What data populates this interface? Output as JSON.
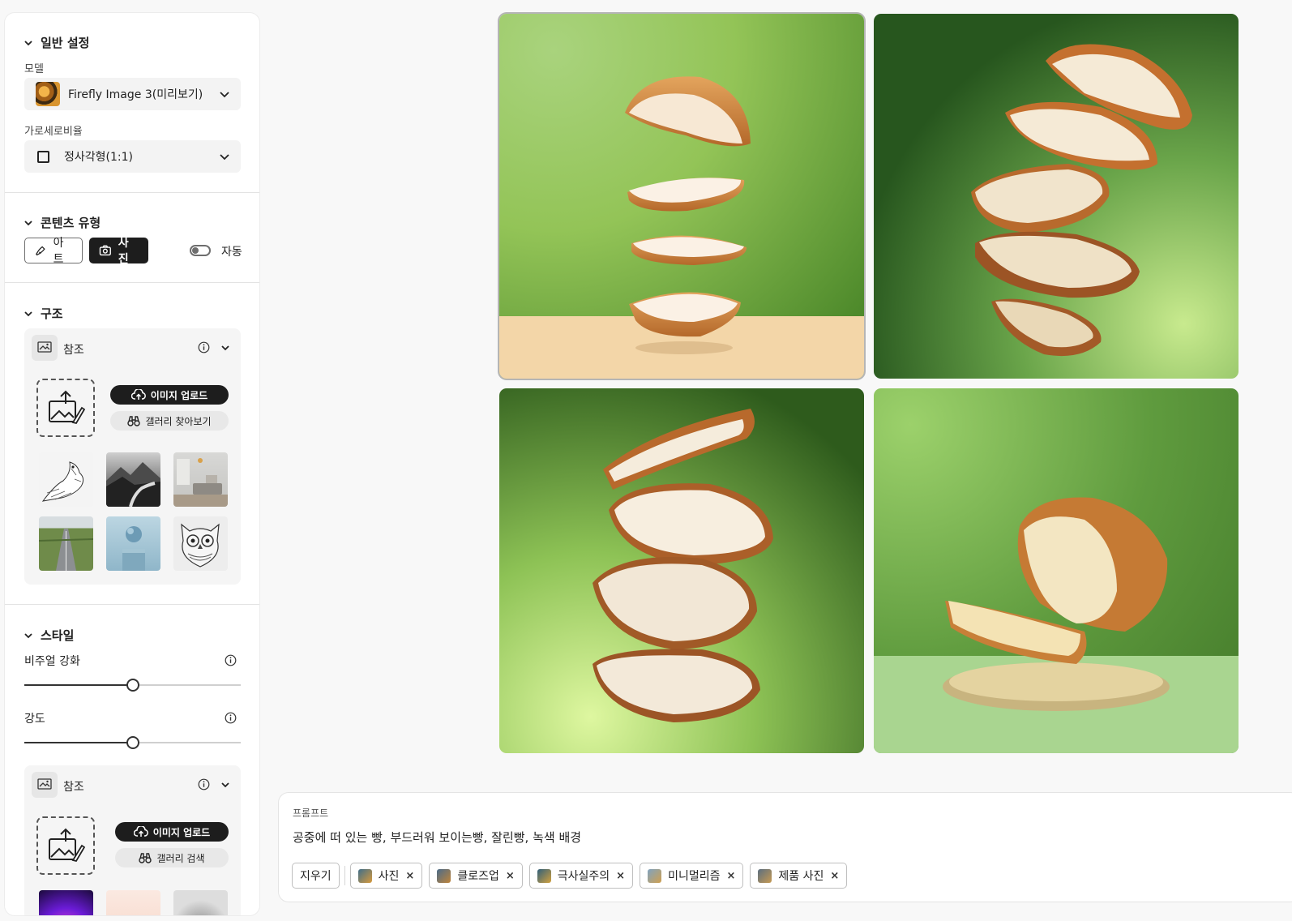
{
  "sidebar": {
    "general": {
      "title": "일반 설정",
      "model_label": "모델",
      "model_value": "Firefly Image 3(미리보기)",
      "aspect_label": "가로세로비율",
      "aspect_value": "정사각형(1:1)"
    },
    "content_type": {
      "title": "콘텐츠 유형",
      "art_label": "아트",
      "photo_label": "사진",
      "selected": "사진",
      "auto_label": "자동",
      "auto_on": false
    },
    "structure": {
      "title": "구조",
      "ref_title": "참조",
      "upload_label": "이미지 업로드",
      "browse_label": "갤러리 찾아보기",
      "thumbnails": [
        "bird-sketch",
        "mountain-river-bw",
        "living-room",
        "road-field",
        "sphere-pedestal",
        "owl-sketch"
      ]
    },
    "style": {
      "title": "스타일",
      "visual_label": "비주얼 강화",
      "visual_value": 0.5,
      "strength_label": "강도",
      "strength_value": 0.5,
      "ref_title": "참조",
      "upload_label": "이미지 업로드",
      "browse_label": "갤러리 검색"
    }
  },
  "images": [
    {
      "name": "bread-slices-green-beige-table",
      "selected": true
    },
    {
      "name": "bread-slices-dark-green"
    },
    {
      "name": "bread-slices-green-gradient"
    },
    {
      "name": "bread-loaf-plate-light-green"
    }
  ],
  "prompt": {
    "label": "프롬프트",
    "text": "공중에 떠 있는 빵, 부드러워 보이는빵, 잘린빵, 녹색 배경",
    "clear_label": "지우기",
    "chips": [
      {
        "label": "사진",
        "remove": "×"
      },
      {
        "label": "클로즈업",
        "remove": "×"
      },
      {
        "label": "극사실주의",
        "remove": "×"
      },
      {
        "label": "미니멀리즘",
        "remove": "×"
      },
      {
        "label": "제품 사진",
        "remove": "×"
      }
    ]
  },
  "colors": {
    "accent_dark": "#1d1d1d",
    "panel_bg": "#ffffff",
    "page_bg": "#f8f8f8"
  }
}
